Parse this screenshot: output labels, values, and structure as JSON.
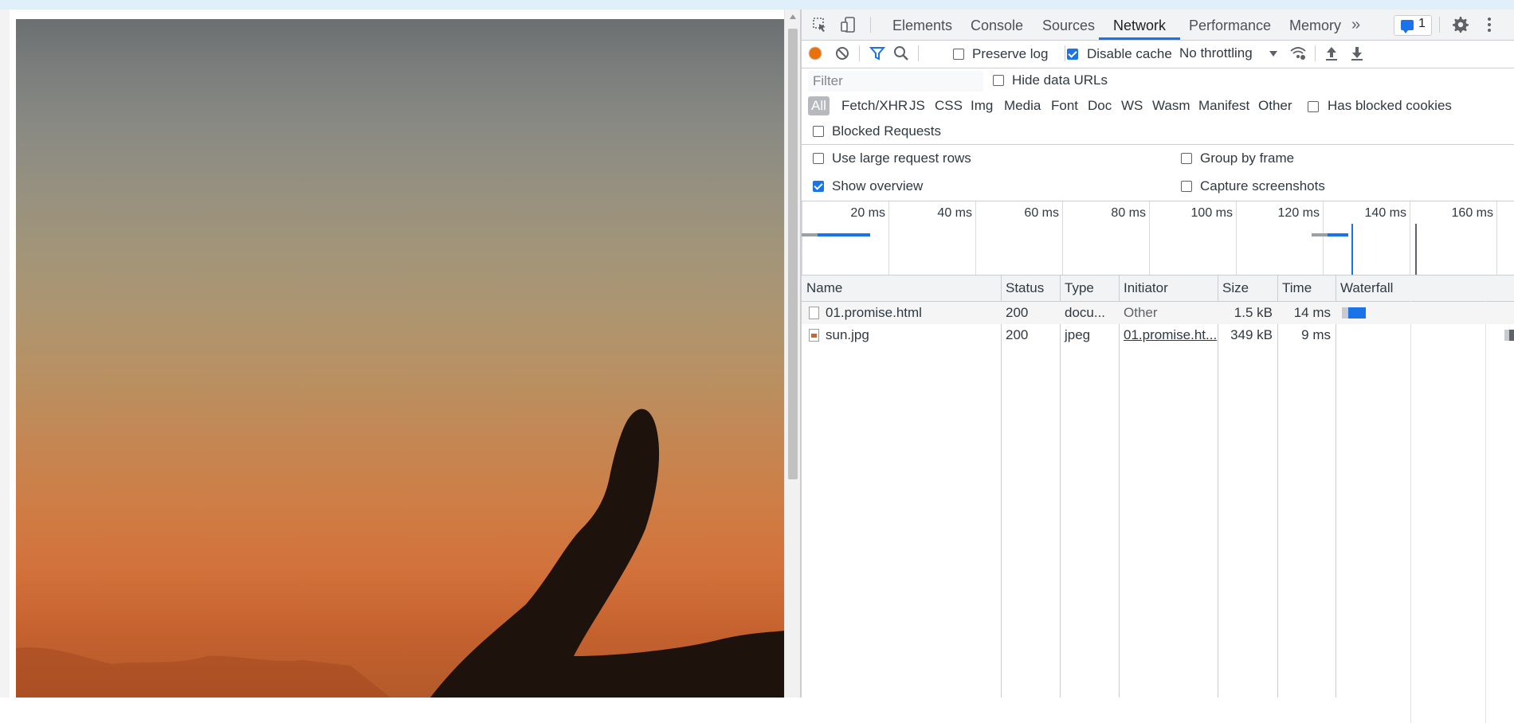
{
  "devtools": {
    "tabs": [
      {
        "label": "Elements"
      },
      {
        "label": "Console"
      },
      {
        "label": "Sources"
      },
      {
        "label": "Network"
      },
      {
        "label": "Performance"
      },
      {
        "label": "Memory"
      }
    ],
    "more_tabs": "»",
    "issues_count": "1"
  },
  "toolbar": {
    "preserve_log": {
      "label": "Preserve log",
      "checked": false
    },
    "disable_cache": {
      "label": "Disable cache",
      "checked": true
    },
    "throttling": "No throttling"
  },
  "filter": {
    "placeholder": "Filter",
    "hide_data_urls": {
      "label": "Hide data URLs",
      "checked": false
    },
    "types": [
      "All",
      "Fetch/XHR",
      "JS",
      "CSS",
      "Img",
      "Media",
      "Font",
      "Doc",
      "WS",
      "Wasm",
      "Manifest",
      "Other"
    ],
    "active_type": "All",
    "has_blocked_cookies": {
      "label": "Has blocked cookies",
      "checked": false
    },
    "blocked_requests": {
      "label": "Blocked Requests",
      "checked": false
    }
  },
  "settings": {
    "use_large_rows": {
      "label": "Use large request rows",
      "checked": false
    },
    "group_by_frame": {
      "label": "Group by frame",
      "checked": false
    },
    "show_overview": {
      "label": "Show overview",
      "checked": true
    },
    "capture_screenshots": {
      "label": "Capture screenshots",
      "checked": false
    }
  },
  "overview": {
    "ticks": [
      "20 ms",
      "40 ms",
      "60 ms",
      "80 ms",
      "100 ms",
      "120 ms",
      "140 ms",
      "160 ms"
    ],
    "colors": {
      "document": "#1a73e8",
      "waiting": "#9aa0a6",
      "dom_content_loaded": "#1a73e8",
      "load": "#5f6368"
    }
  },
  "table": {
    "columns": [
      "Name",
      "Status",
      "Type",
      "Initiator",
      "Size",
      "Time",
      "Waterfall"
    ],
    "rows": [
      {
        "name": "01.promise.html",
        "status": "200",
        "type": "docu...",
        "initiator": "Other",
        "size": "1.5 kB",
        "time": "14 ms",
        "icon": "document-icon"
      },
      {
        "name": "sun.jpg",
        "status": "200",
        "type": "jpeg",
        "initiator": "01.promise.ht...",
        "size": "349 kB",
        "time": "9 ms",
        "icon": "image-icon"
      }
    ]
  }
}
